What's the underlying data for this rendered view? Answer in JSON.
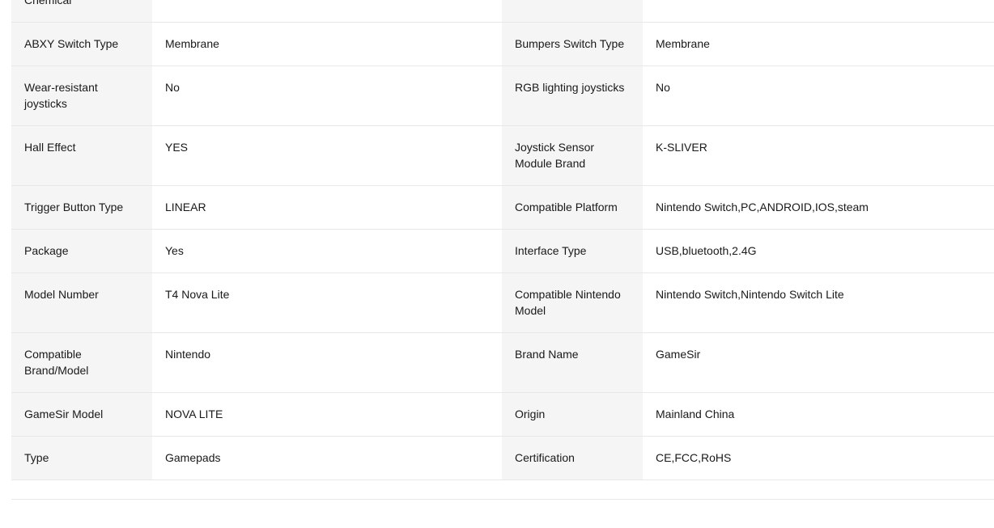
{
  "specs": [
    {
      "k1": "Chemical",
      "v1": "",
      "k2": "",
      "v2": ""
    },
    {
      "k1": "ABXY Switch Type",
      "v1": "Membrane",
      "k2": "Bumpers Switch Type",
      "v2": "Membrane"
    },
    {
      "k1": "Wear-resistant joysticks",
      "v1": "No",
      "k2": "RGB lighting joysticks",
      "v2": "No"
    },
    {
      "k1": "Hall Effect",
      "v1": "YES",
      "k2": "Joystick Sensor Module Brand",
      "v2": "K-SLIVER"
    },
    {
      "k1": "Trigger Button Type",
      "v1": "LINEAR",
      "k2": "Compatible Platform",
      "v2": "Nintendo Switch,PC,ANDROID,IOS,steam"
    },
    {
      "k1": "Package",
      "v1": "Yes",
      "k2": "Interface Type",
      "v2": "USB,bluetooth,2.4G"
    },
    {
      "k1": "Model Number",
      "v1": "T4 Nova Lite",
      "k2": "Compatible Nintendo Model",
      "v2": "Nintendo Switch,Nintendo Switch Lite"
    },
    {
      "k1": "Compatible Brand/Model",
      "v1": "Nintendo",
      "k2": "Brand Name",
      "v2": "GameSir"
    },
    {
      "k1": "GameSir Model",
      "v1": "NOVA LITE",
      "k2": "Origin",
      "v2": "Mainland China"
    },
    {
      "k1": "Type",
      "v1": "Gamepads",
      "k2": "Certification",
      "v2": "CE,FCC,RoHS"
    }
  ]
}
